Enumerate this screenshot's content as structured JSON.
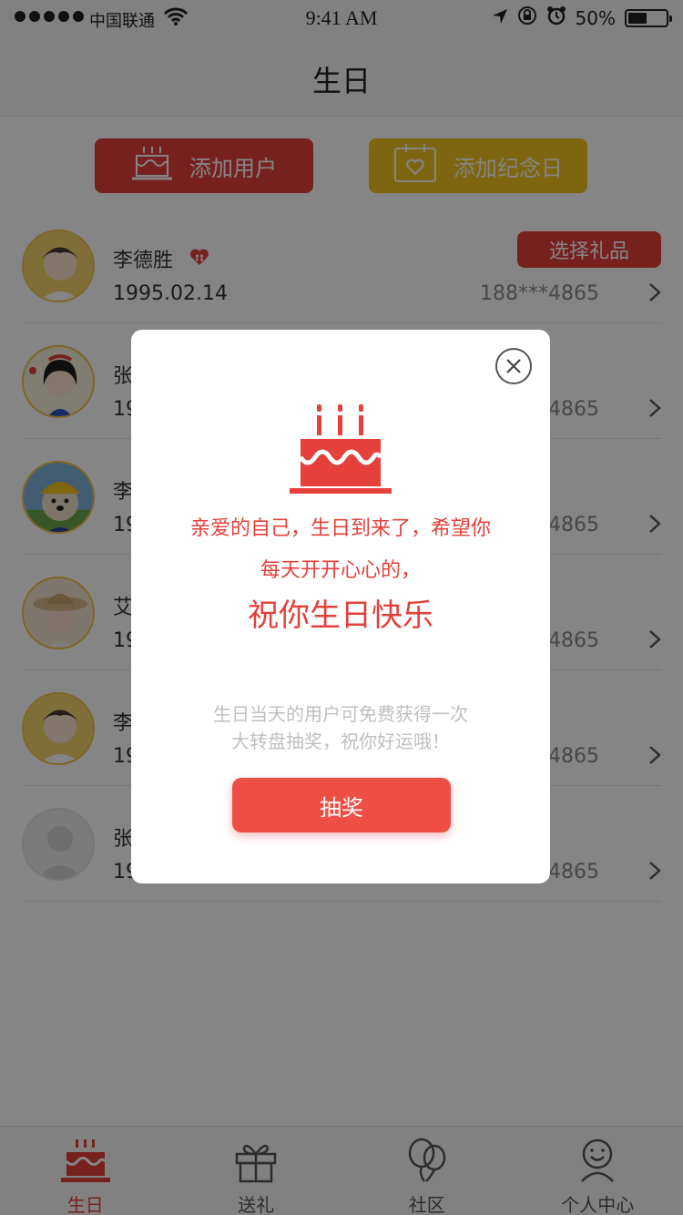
{
  "status_bar": {
    "carrier": "中国联通",
    "time": "9:41 AM",
    "battery": "50%",
    "battery_level": 0.5
  },
  "nav": {
    "title": "生日"
  },
  "actions": {
    "add_user": "添加用户",
    "add_anniversary": "添加纪念日"
  },
  "contacts": [
    {
      "name": "李德胜",
      "date": "1995.02.14",
      "phone": "188***4865",
      "action": "选择礼品",
      "avatar_icon": "boy-avatar"
    },
    {
      "name": "张",
      "date": "19",
      "phone": "4865",
      "avatar_icon": "snow-white-avatar"
    },
    {
      "name": "李",
      "date": "19",
      "phone": "4865",
      "avatar_icon": "dog-avatar"
    },
    {
      "name": "艾",
      "date": "19",
      "phone": "4865",
      "avatar_icon": "hat-girl-avatar"
    },
    {
      "name": "李",
      "date": "19",
      "phone": "4865",
      "avatar_icon": "boy-avatar"
    },
    {
      "name": "张",
      "date": "19",
      "phone": "4865",
      "avatar_icon": "default-avatar"
    }
  ],
  "tabs": [
    {
      "label": "生日",
      "icon": "cake-icon",
      "active": true
    },
    {
      "label": "送礼",
      "icon": "gift-icon",
      "active": false
    },
    {
      "label": "社区",
      "icon": "balloons-icon",
      "active": false
    },
    {
      "label": "个人中心",
      "icon": "person-icon",
      "active": false
    }
  ],
  "modal": {
    "line1": "亲爱的自己，生日到来了，希望你",
    "line2": "每天开开心心的，",
    "wish": "祝你生日快乐",
    "hint_line1": "生日当天的用户可免费获得一次",
    "hint_line2": "大转盘抽奖，祝你好运哦！",
    "button": "抽奖"
  },
  "colors": {
    "primary": "#e5403b",
    "accent_yellow": "#f2c21d",
    "hint_gray": "#bfbfbf"
  }
}
